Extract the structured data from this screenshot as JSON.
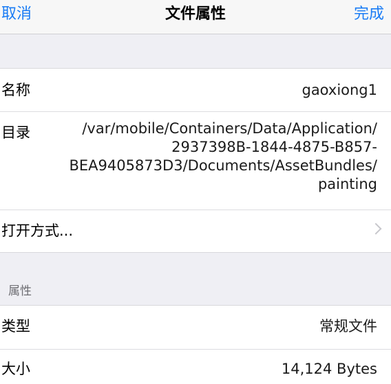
{
  "navbar": {
    "cancel_label": "取消",
    "title": "文件属性",
    "done_label": "完成"
  },
  "file_section": {
    "name_label": "名称",
    "name_value": "gaoxiong1",
    "dir_label": "目录",
    "dir_lines": [
      "/var/mobile/Containers/Data/Application/",
      "2937398B-1844-4875-B857-",
      "BEA9405873D3/Documents/AssetBundles/",
      "painting"
    ],
    "open_with_label": "打开方式..."
  },
  "properties_section": {
    "header": "属性",
    "type_label": "类型",
    "type_value": "常规文件",
    "size_label": "大小",
    "size_value": "14,124 Bytes"
  },
  "colors": {
    "accent": "#1a7cf5",
    "background": "#efeff4"
  },
  "icons": {
    "open_with_disclosure": "chevron-right-icon"
  }
}
